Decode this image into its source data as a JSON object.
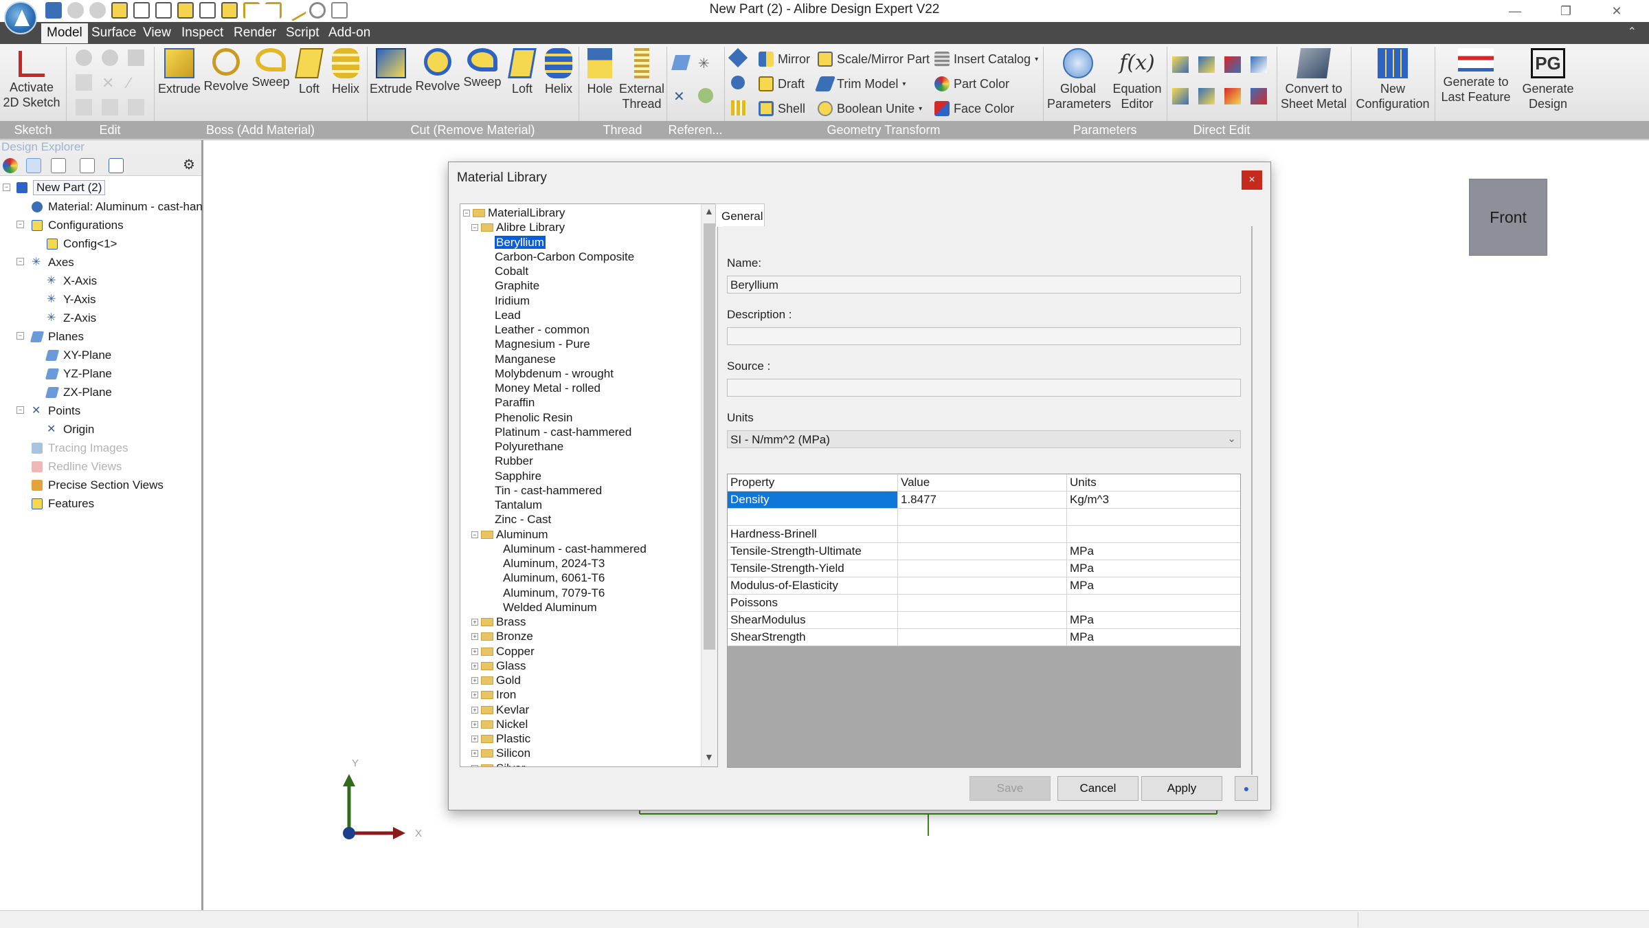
{
  "window": {
    "title": "New Part (2) - Alibre Design Expert V22",
    "controls": [
      "—",
      "❐",
      "✕"
    ]
  },
  "menu": {
    "items": [
      "Model",
      "Surface",
      "View",
      "Inspect",
      "Render",
      "Script",
      "Add-on"
    ],
    "active": "Model",
    "right_icon": "⌃"
  },
  "ribbon": {
    "activate": "Activate\n2D Sketch",
    "boss": {
      "extrude": "Extrude",
      "revolve": "Revolve",
      "sweep": "Sweep",
      "loft": "Loft",
      "helix": "Helix"
    },
    "cut": {
      "extrude": "Extrude",
      "revolve": "Revolve",
      "sweep": "Sweep",
      "loft": "Loft",
      "helix": "Helix"
    },
    "hole": "Hole",
    "external_thread": "External\nThread",
    "mirror": "Mirror",
    "draft": "Draft",
    "shell": "Shell",
    "scale_mirror": "Scale/Mirror Part",
    "trim_model": "Trim Model",
    "boolean_unite": "Boolean Unite",
    "insert_catalog": "Insert Catalog",
    "part_color": "Part Color",
    "face_color": "Face Color",
    "global_params": "Global\nParameters",
    "equation_editor": "Equation\nEditor",
    "convert_sheet": "Convert to\nSheet Metal",
    "new_config": "New\nConfiguration",
    "generate_last": "Generate to\nLast Feature",
    "generate_design": "Generate\nDesign",
    "groups": [
      "Sketch",
      "Edit",
      "Boss (Add Material)",
      "Cut (Remove Material)",
      "Thread",
      "Referen...",
      "Geometry Transform",
      "Parameters",
      "Direct Edit"
    ]
  },
  "explorer": {
    "title": "Design Explorer",
    "tree": [
      {
        "label": "New Part (2)"
      },
      {
        "label": "Material: Aluminum - cast-han"
      },
      {
        "label": "Configurations"
      },
      {
        "label": "Config<1>"
      },
      {
        "label": "Axes"
      },
      {
        "label": "X-Axis"
      },
      {
        "label": "Y-Axis"
      },
      {
        "label": "Z-Axis"
      },
      {
        "label": "Planes"
      },
      {
        "label": "XY-Plane"
      },
      {
        "label": "YZ-Plane"
      },
      {
        "label": "ZX-Plane"
      },
      {
        "label": "Points"
      },
      {
        "label": "Origin"
      },
      {
        "label": "Tracing Images"
      },
      {
        "label": "Redline Views"
      },
      {
        "label": "Precise Section Views"
      },
      {
        "label": "Features"
      }
    ]
  },
  "viewcube": {
    "label": "Front"
  },
  "axes": {
    "y": "Y",
    "x": "X"
  },
  "dialog": {
    "title": "Material Library",
    "close": "×",
    "library": [
      "MaterialLibrary",
      "Alibre Library",
      "Beryllium",
      "Carbon-Carbon Composite",
      "Cobalt",
      "Graphite",
      "Iridium",
      "Lead",
      "Leather - common",
      "Magnesium - Pure",
      "Manganese",
      "Molybdenum - wrought",
      "Money Metal - rolled",
      "Paraffin",
      "Phenolic Resin",
      "Platinum - cast-hammered",
      "Polyurethane",
      "Rubber",
      "Sapphire",
      "Tin - cast-hammered",
      "Tantalum",
      "Zinc - Cast",
      "Aluminum",
      "Aluminum - cast-hammered",
      "Aluminum, 2024-T3",
      "Aluminum, 6061-T6",
      "Aluminum, 7079-T6",
      "Welded Aluminum",
      "Brass",
      "Bronze",
      "Copper",
      "Glass",
      "Gold",
      "Iron",
      "Kevlar",
      "Nickel",
      "Plastic",
      "Silicon",
      "Silver"
    ],
    "tab": "General",
    "name_label": "Name:",
    "name_value": "Beryllium",
    "description_label": "Description :",
    "description_value": "",
    "source_label": "Source :",
    "source_value": "",
    "units_label": "Units",
    "units_value": "SI - N/mm^2 (MPa)",
    "grid": {
      "headers": [
        "Property",
        "Value",
        "Units"
      ],
      "rows": [
        [
          "Density",
          "1.8477",
          "Kg/m^3"
        ],
        [
          "",
          "",
          ""
        ],
        [
          "Hardness-Brinell",
          "",
          ""
        ],
        [
          "Tensile-Strength-Ultimate",
          "",
          "MPa"
        ],
        [
          "Tensile-Strength-Yield",
          "",
          "MPa"
        ],
        [
          "Modulus-of-Elasticity",
          "",
          "MPa"
        ],
        [
          "Poissons",
          "",
          ""
        ],
        [
          "ShearModulus",
          "",
          "MPa"
        ],
        [
          "ShearStrength",
          "",
          "MPa"
        ]
      ]
    },
    "buttons": {
      "save": "Save",
      "cancel": "Cancel",
      "apply": "Apply",
      "help": "●"
    }
  }
}
